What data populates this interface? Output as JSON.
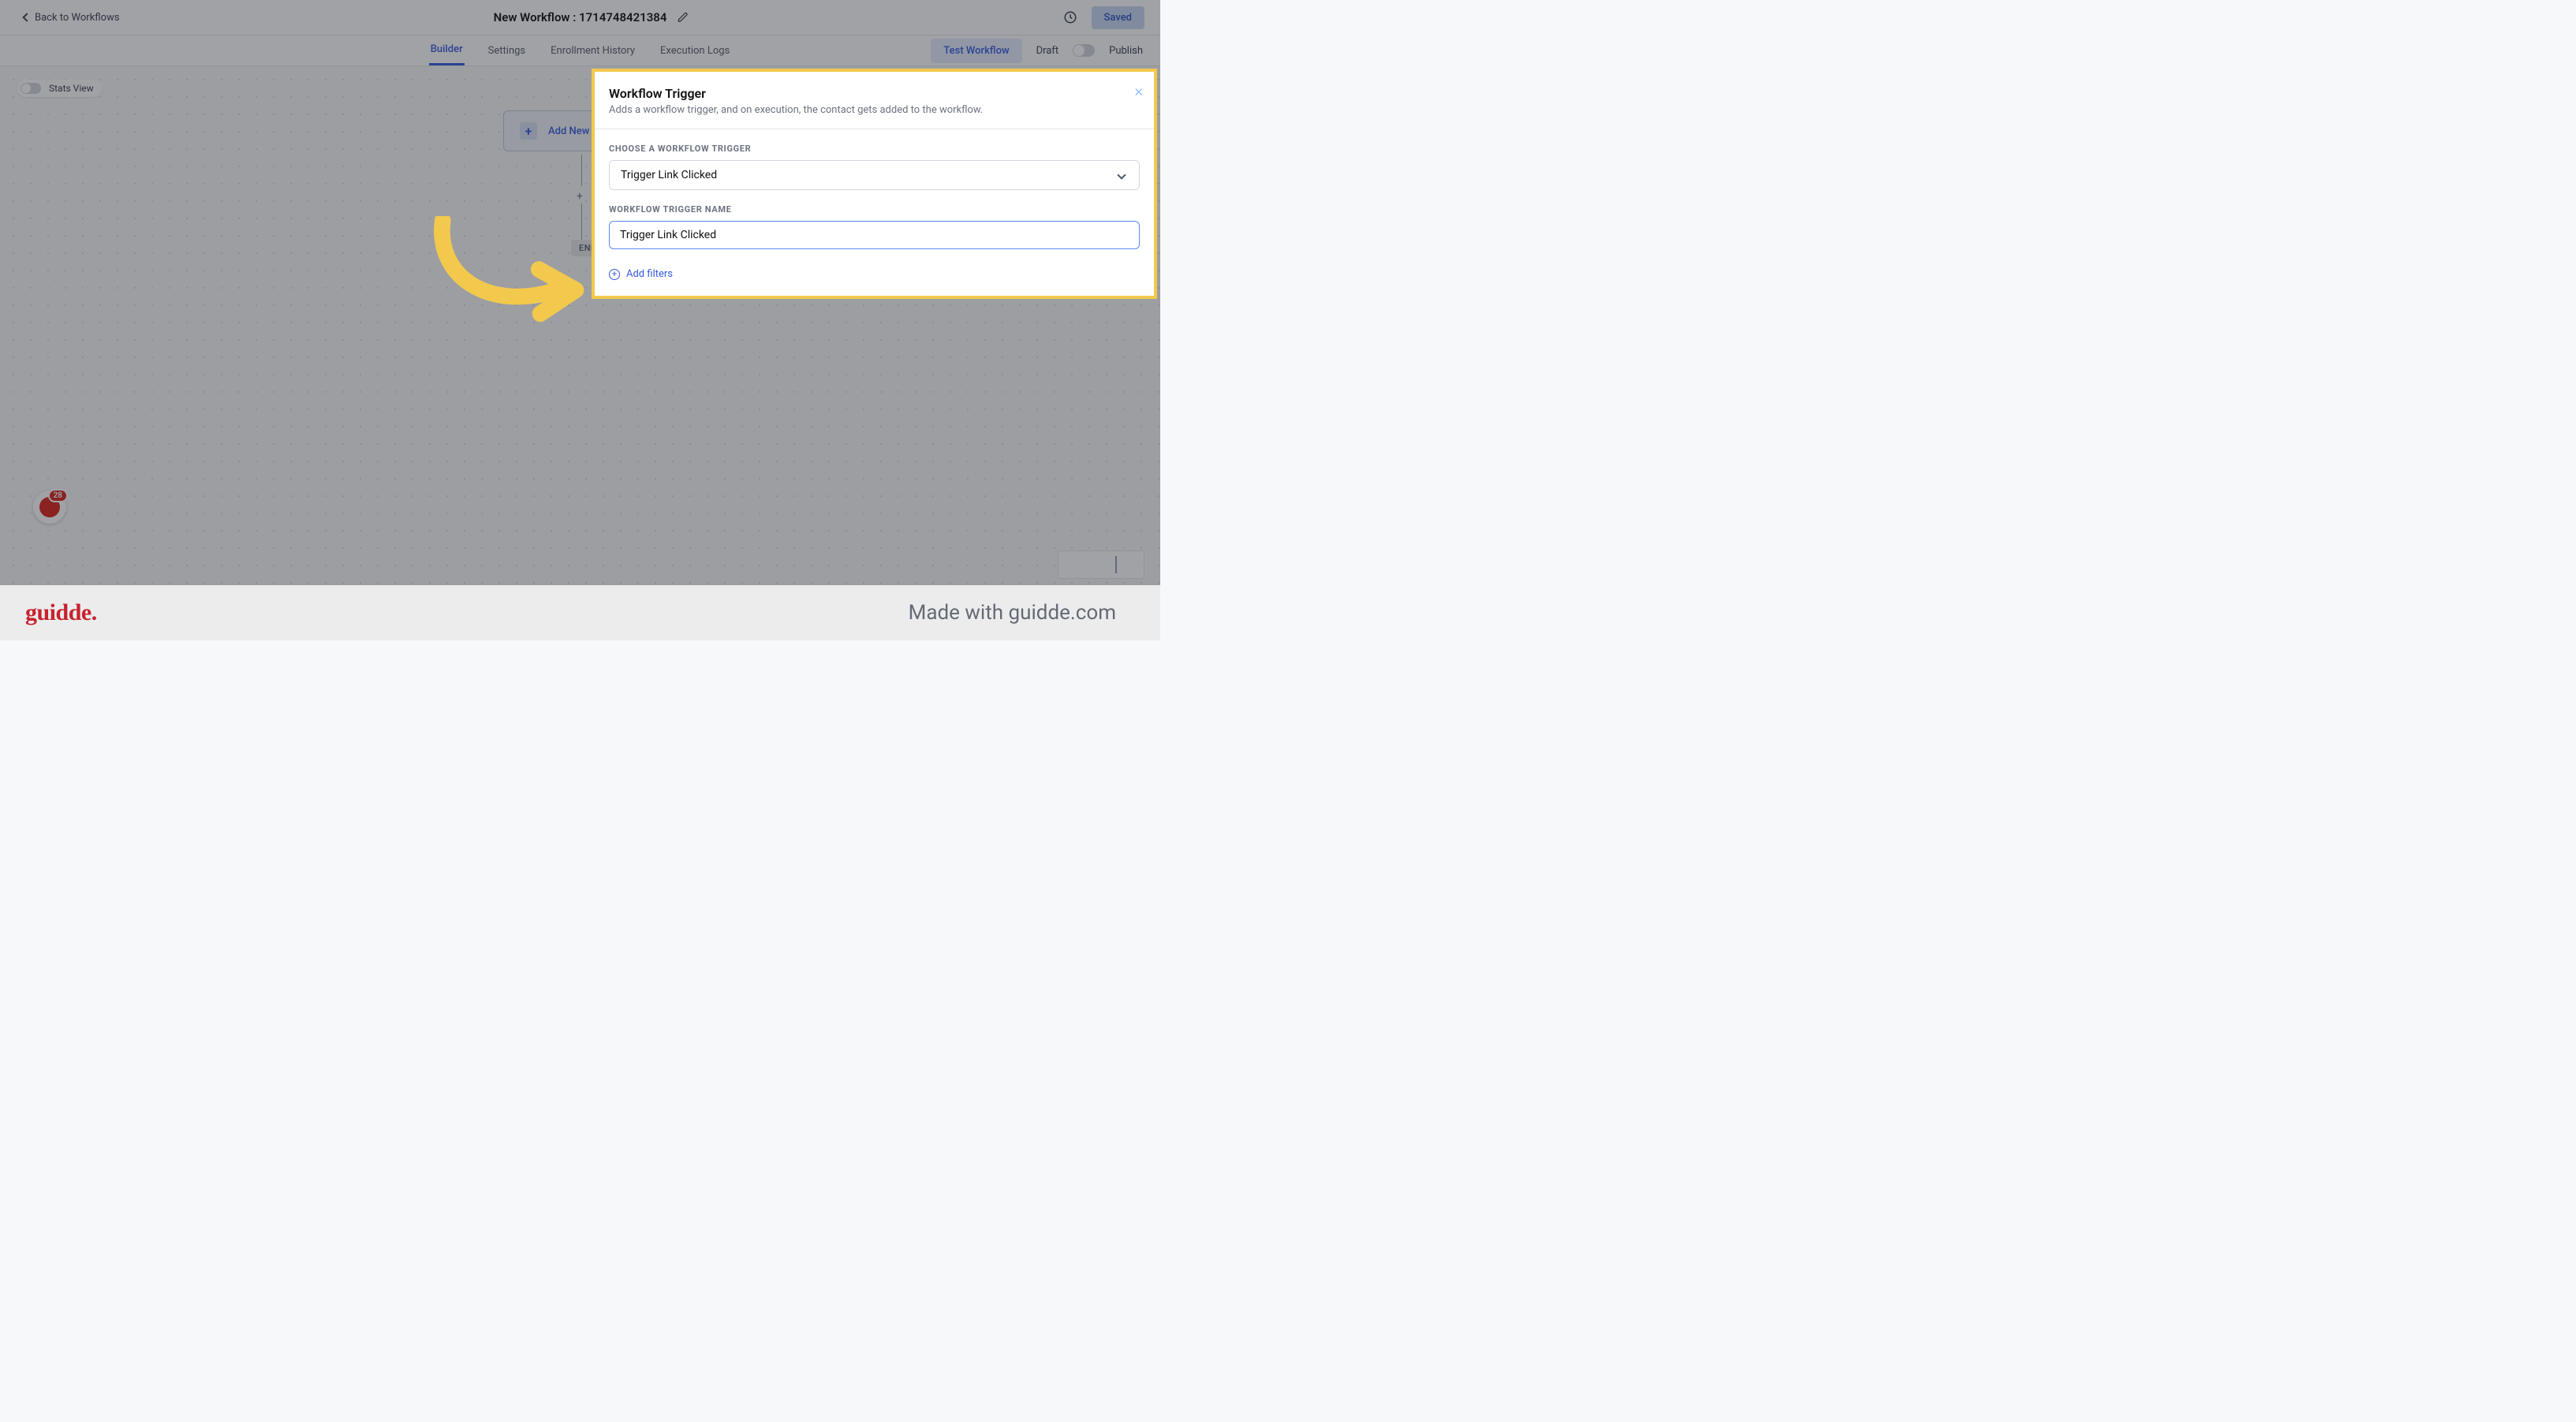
{
  "topbar": {
    "back_label": "Back to Workflows",
    "title": "New Workflow : 1714748421384",
    "saved_label": "Saved"
  },
  "tabs": {
    "builder": "Builder",
    "settings": "Settings",
    "enrollment": "Enrollment History",
    "execution": "Execution Logs",
    "test_workflow": "Test Workflow",
    "draft": "Draft",
    "publish": "Publish"
  },
  "canvas": {
    "stats_view": "Stats View",
    "add_trigger": "Add New Trigger",
    "end": "END",
    "plus": "+",
    "badge_count": "28"
  },
  "panel": {
    "title": "Workflow Trigger",
    "desc": "Adds a workflow trigger, and on execution, the contact gets added to the workflow.",
    "choose_label": "CHOOSE A WORKFLOW TRIGGER",
    "select_value": "Trigger Link Clicked",
    "name_label": "WORKFLOW TRIGGER NAME",
    "name_value": "Trigger Link Clicked",
    "add_filters": "Add filters"
  },
  "footer": {
    "logo": "guidde.",
    "made_with": "Made with guidde.com"
  }
}
